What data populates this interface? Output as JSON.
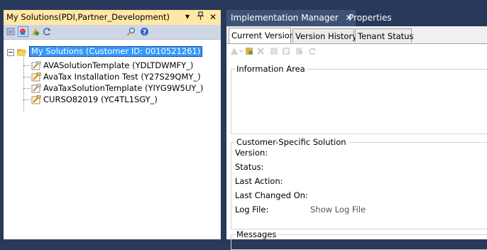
{
  "left_panel": {
    "title": "My Solutions(PDI,Partner_Development)",
    "pin_glyph": "▕",
    "dropdown_glyph": "▾",
    "close_glyph": "✕",
    "toolbar_icons": [
      "open-icon",
      "active-solutions-icon",
      "create-solution-icon",
      "refresh-icon",
      "find-icon",
      "help-icon"
    ],
    "tree": {
      "root": {
        "label": "My Solutions (Customer ID: 0010521261)",
        "icon": "folder-open-icon"
      },
      "children": [
        {
          "label": "AVASolutionTemplate (YDLTDWMFY_)",
          "icon": "solution-icon"
        },
        {
          "label": "AvaTax Installation Test (Y27S29QMY_)",
          "icon": "solution-active-icon"
        },
        {
          "label": "AvaTaxSolutionTemplate (YIYG9W5UY_)",
          "icon": "solution-icon"
        },
        {
          "label": "CURSO82019 (YC4TL1SGY_)",
          "icon": "solution-active-icon"
        }
      ]
    }
  },
  "right_panel": {
    "document_tabs": [
      {
        "label": "Implementation Manager",
        "close_glyph": "✕"
      },
      {
        "label": "Properties"
      }
    ],
    "inner_tabs": [
      "Current Version",
      "Version History",
      "Tenant Status"
    ],
    "toolbar_icons": [
      "activate-icon",
      "assemble-icon",
      "disabled-icon",
      "copy-icon",
      "compare-icon",
      "download-icon",
      "refresh-icon"
    ],
    "information_area": {
      "title": "Information Area"
    },
    "customer_specific_solution": {
      "title": "Customer-Specific Solution",
      "fields": {
        "version": "Version:",
        "status": "Status:",
        "last_action": "Last Action:",
        "last_changed_on": "Last Changed On:",
        "log_file": "Log File:"
      },
      "show_log_file": "Show Log File"
    },
    "messages": {
      "title": "Messages"
    }
  },
  "colors": {
    "ide_background": "#29395b",
    "active_panel_title": "#ffe8a6",
    "selection": "#3399ff",
    "active_doc_tab": "#3d5277"
  }
}
